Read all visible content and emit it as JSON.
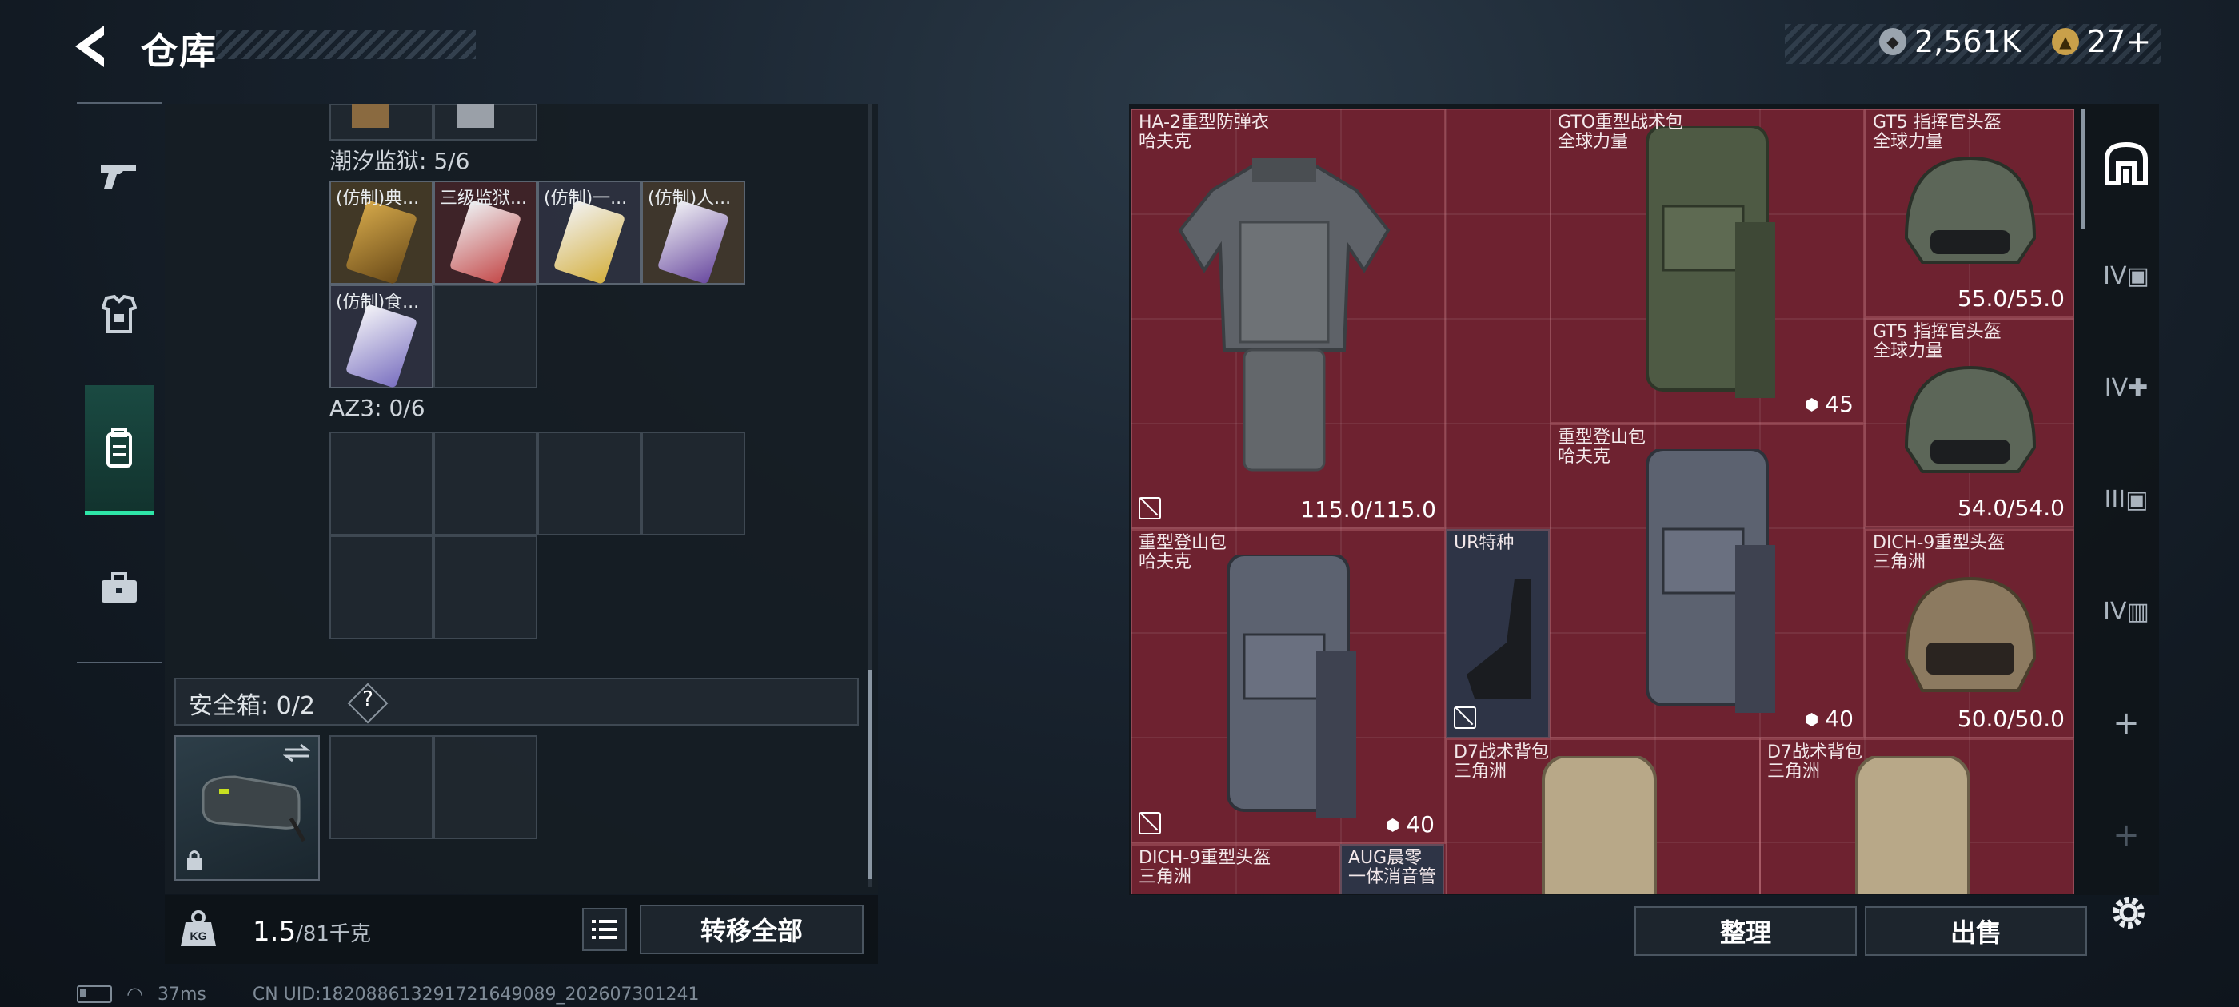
{
  "header": {
    "title": "仓库"
  },
  "currency": {
    "silver": "2,561K",
    "gold": "27+"
  },
  "left_nav": {
    "items": [
      {
        "name": "weapons"
      },
      {
        "name": "armor"
      },
      {
        "name": "backpack"
      },
      {
        "name": "toolbox"
      }
    ]
  },
  "left_panel": {
    "section1_label": "潮汐监狱: 5/6",
    "section1_items": [
      "(仿制)典...",
      "三级监狱...",
      "(仿制)一...",
      "(仿制)人...",
      "(仿制)食..."
    ],
    "section2_label": "AZ3: 0/6",
    "safe_label": "安全箱: 0/2",
    "safe_help": "?"
  },
  "weight": {
    "current": "1.5",
    "max": "/81千克"
  },
  "buttons": {
    "transfer_all": "转移全部",
    "sort": "整理",
    "sell": "出售"
  },
  "status": {
    "ping": "37ms",
    "uid": "CN UID:1820886132917216490​89_202607301241"
  },
  "stash_items": [
    {
      "name": "HA-2重型防弹衣",
      "brand": "哈夫克",
      "durability": "115.0/115.0"
    },
    {
      "name": "GTO重型战术包",
      "brand": "全球力量",
      "weight": "45"
    },
    {
      "name": "GT5 指挥官头盔",
      "brand": "全球力量",
      "durability": "55.0/55.0"
    },
    {
      "name": "GT5 指挥官头盔",
      "brand": "全球力量",
      "durability": "54.0/54.0"
    },
    {
      "name": "重型登山包",
      "brand": "哈夫克",
      "weight": "40"
    },
    {
      "name": "重型登山包",
      "brand": "哈夫克",
      "weight": "40"
    },
    {
      "name": "UR特种"
    },
    {
      "name": "DICH-9重型头盔",
      "brand": "三角洲",
      "durability": "50.0/50.0"
    },
    {
      "name": "D7战术背包",
      "brand": "三角洲"
    },
    {
      "name": "D7战术背包",
      "brand": "三角洲"
    },
    {
      "name": "DICH-9重型头盔",
      "brand": "三角洲"
    },
    {
      "name": "AUG晨零",
      "brand": "一体消音管"
    }
  ],
  "right_nav": {
    "items": [
      "all",
      "IV",
      "IV",
      "III",
      "IV",
      "+",
      "+"
    ]
  }
}
